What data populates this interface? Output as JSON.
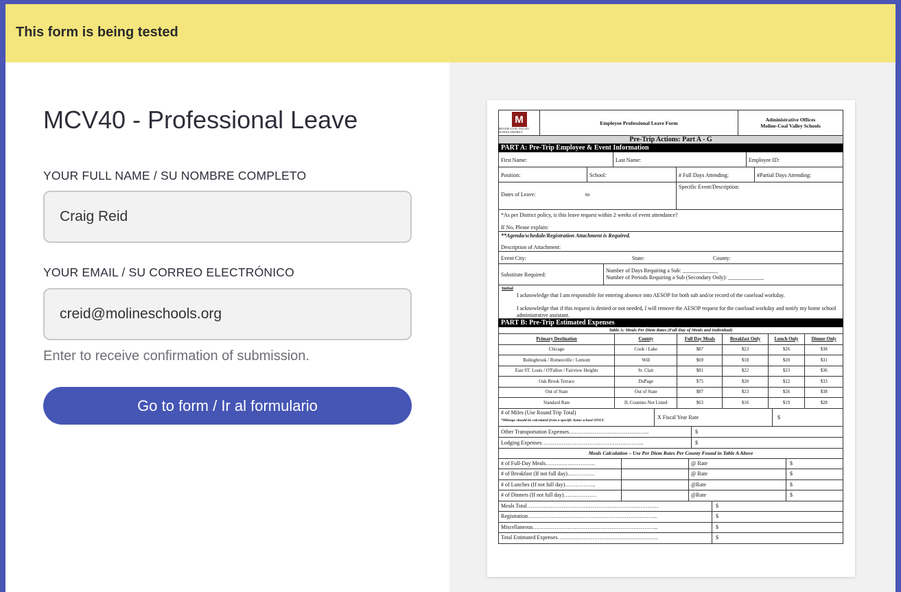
{
  "banner": {
    "text": "This form is being tested"
  },
  "form": {
    "title": "MCV40 - Professional Leave",
    "name_label": "YOUR FULL NAME / SU NOMBRE COMPLETO",
    "name_value": "Craig Reid",
    "email_label": "YOUR EMAIL / SU CORREO ELECTRÓNICO",
    "email_value": "creid@molineschools.org",
    "hint": "Enter to receive confirmation of submission.",
    "button": "Go to form / Ir al formulario"
  },
  "doc": {
    "logo_letter": "M",
    "logo_sub": "MOLINE-COAL VALLEY SCHOOL DISTRICT",
    "title": "Employee Professional Leave Form",
    "office_1": "Administrative Offices",
    "office_2": "Moline-Coal Valley Schools",
    "pre_trip": "Pre-Trip Actions: Part A - G",
    "part_a": "PART A: Pre-Trip Employee & Event Information",
    "first_name": "First Name:",
    "last_name": "Last Name:",
    "employee_id": "Employee ID:",
    "position": "Position:",
    "school": "School:",
    "full_days": "# Full Days Attending:",
    "partial_days": "#Partial Days Attending:",
    "dates": "Dates of Leave:",
    "to": "to",
    "event_desc": "Specific Event/Description:",
    "policy": "*As per District policy, is this leave request within 2 weeks of event attendance?",
    "explain": "If No, Please explain:",
    "agenda": "**Agenda/schedule/Registration Attachment is Required.",
    "attach_desc": "Description of Attachment:",
    "event_city": "Event City:",
    "state": "State:",
    "county": "County:",
    "sub_required": "Substitute Required:",
    "days_sub": "Number of Days Requiring a Sub:  _____________",
    "periods_sub": "Number of Periods Requiring a Sub (Secondary Only):  _____________",
    "initial": "Initial",
    "ack_1": "I acknowledge that I am responsible for entering absence into AESOP for both sub and/or record of the caseload workday.",
    "ack_2": "I acknowledge that if this request is denied or not needed, I will remove the AESOP request for the caseload workday and notify my home school administrative assistant.",
    "part_b": "PART B: Pre-Trip Estimated Expenses",
    "table_a": "Table A: Meals Per Diem Rates (Full Day of Meals and Individual)",
    "headers": [
      "Primary Destination",
      "County",
      "Full Day Meals",
      "Breakfast Only",
      "Lunch Only",
      "Dinner Only"
    ],
    "rates": [
      [
        "Chicago",
        "Cook / Lake",
        "$87",
        "$23",
        "$26",
        "$38"
      ],
      [
        "Bolingbrook / Romeoville / Lemont",
        "Will",
        "$69",
        "$18",
        "$20",
        "$31"
      ],
      [
        "East ST. Louis / O'Fallon / Fairview Heights",
        "St. Clair",
        "$81",
        "$22",
        "$23",
        "$36"
      ],
      [
        "Oak Brook Terrace",
        "DuPage",
        "$75",
        "$20",
        "$22",
        "$33"
      ],
      [
        "Out of State",
        "Out of State",
        "$87",
        "$23",
        "$26",
        "$38"
      ],
      [
        "Standard Rate",
        "IL Counties Not Listed",
        "$63",
        "$16",
        "$19",
        "$28"
      ]
    ],
    "miles": "# of Miles (Use Round Trip Total)",
    "miles_note": "*Mileage should be calculated from a specific home school ONLY.",
    "fiscal_rate": "X Fiscal Year Rate",
    "dollar": "$",
    "other_transport": "Other Transportation Expenses……………………………………..",
    "lodging": "Lodging Expenses………………………………………………..",
    "meals_calc": "Meals Calculation – Use Per Diem Rates Per County Found in Table A Above",
    "full_day_meals": "# of Full-Day Meals………………………",
    "breakfast": "# of Breakfast (If not full day)……………",
    "lunches": "# of Lunches (If not full day)……………..",
    "dinners": "# of Dinners (If not full day)………………",
    "at_rate": "@ Rate",
    "at_rate2": "@Rate",
    "meals_total": "Meals Total………………………………………………………………",
    "registration": "Registration……………………………………………………………..",
    "misc": "Miscellaneous…………………………………………………………...",
    "total": "Total Estimated Expenses………………………………………………."
  }
}
